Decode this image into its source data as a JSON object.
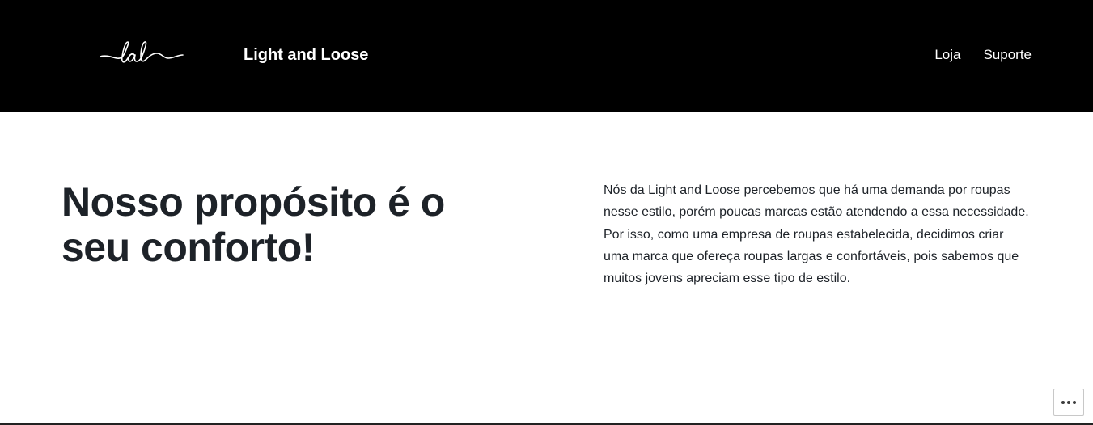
{
  "header": {
    "logo_icon": "lal-script-logo",
    "site_title": "Light and Loose",
    "nav": [
      {
        "label": "Loja"
      },
      {
        "label": "Suporte"
      }
    ]
  },
  "hero": {
    "heading": "Nosso propósito é o seu conforto!",
    "paragraph": "Nós da Light and Loose percebemos que há uma demanda por roupas nesse estilo, porém poucas marcas estão atendendo a essa necessidade. Por isso, como uma empresa de roupas estabelecida, decidimos criar uma marca que ofereça roupas largas e confortáveis, pois sabemos que muitos jovens apreciam esse tipo de estilo."
  },
  "floating_actions": {
    "more_icon": "ellipsis-icon"
  },
  "colors": {
    "header_bg": "#000000",
    "header_text": "#ffffff",
    "body_text": "#1d2228",
    "page_bg": "#ffffff"
  }
}
